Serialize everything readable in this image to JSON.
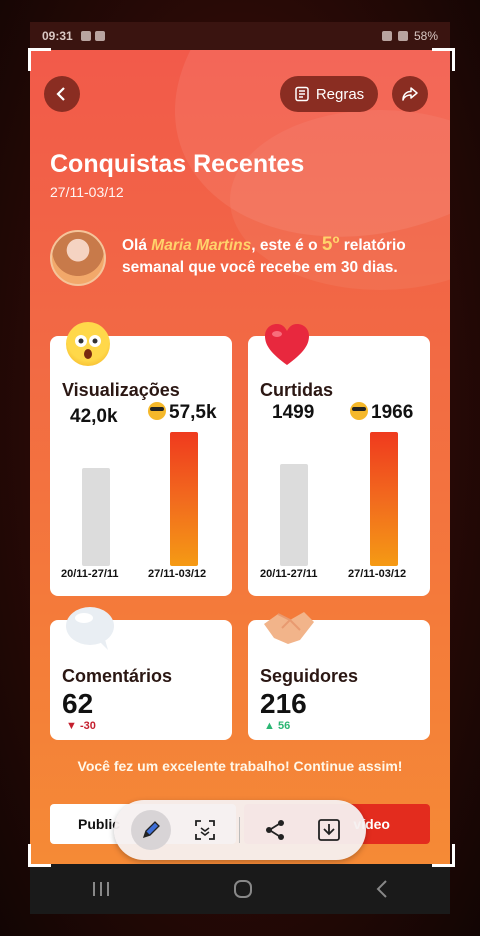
{
  "status_bar": {
    "time": "09:31",
    "battery": "58%"
  },
  "header": {
    "back_icon": "chevron-left-icon",
    "rules_label": "Regras",
    "rules_icon": "document-icon",
    "share_icon": "share-arrow-icon"
  },
  "title": "Conquistas Recentes",
  "date_range": "27/11-03/12",
  "greeting": {
    "prefix": "Olá ",
    "name": "Maria Martins",
    "middle": ", este é o ",
    "number": "5º",
    "suffix": " relatório semanal que você recebe em 30 dias."
  },
  "cards": {
    "views": {
      "title": "Visualizações",
      "previous": "42,0k",
      "current": "57,5k",
      "previous_fraction": 0.73,
      "current_fraction": 1.0,
      "previous_period": "20/11-27/11",
      "current_period": "27/11-03/12"
    },
    "likes": {
      "title": "Curtidas",
      "previous": "1499",
      "current": "1966",
      "previous_fraction": 0.76,
      "current_fraction": 1.0,
      "previous_period": "20/11-27/11",
      "current_period": "27/11-03/12"
    },
    "comments": {
      "title": "Comentários",
      "value": "62",
      "delta": "-30"
    },
    "followers": {
      "title": "Seguidores",
      "value": "216",
      "delta": "56"
    }
  },
  "praise": "Você fez um excelente trabalho! Continue assim!",
  "buttons": {
    "left_label": "Public",
    "right_label": "vídeo"
  },
  "toolbar": [
    "pen-icon",
    "scan-icon",
    "share-icon",
    "download-icon"
  ],
  "colors": {
    "accent": "#e32c1e",
    "highlight": "#ffd36b"
  }
}
